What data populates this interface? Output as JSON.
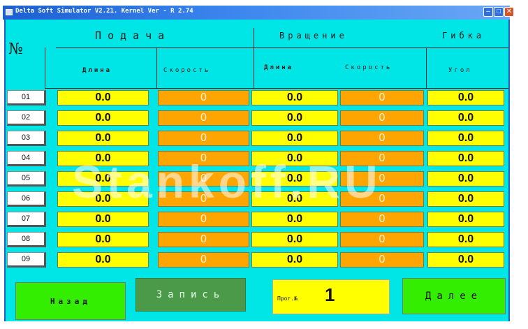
{
  "window": {
    "title": "Delta Soft Simulator V2.21. Kernel Ver - R 2.74",
    "controls": [
      "minimize",
      "maximize",
      "close"
    ]
  },
  "header": {
    "number_label": "№",
    "feed_group": "Подача",
    "rotation_group": "Вращение",
    "bend_group": "Гибка",
    "col_feed_length": "Длина",
    "col_feed_speed": "Скорость",
    "col_rot_length": "Длина",
    "col_rot_speed": "Скорость",
    "col_bend_angle": "Угол"
  },
  "rows": [
    {
      "num": "01",
      "feed_length": "0.0",
      "feed_speed": "0",
      "rot_length": "0.0",
      "rot_speed": "0",
      "angle": "0.0"
    },
    {
      "num": "02",
      "feed_length": "0.0",
      "feed_speed": "0",
      "rot_length": "0.0",
      "rot_speed": "0",
      "angle": "0.0"
    },
    {
      "num": "03",
      "feed_length": "0.0",
      "feed_speed": "0",
      "rot_length": "0.0",
      "rot_speed": "0",
      "angle": "0.0"
    },
    {
      "num": "04",
      "feed_length": "0.0",
      "feed_speed": "0",
      "rot_length": "0.0",
      "rot_speed": "0",
      "angle": "0.0"
    },
    {
      "num": "05",
      "feed_length": "0.0",
      "feed_speed": "0",
      "rot_length": "0.0",
      "rot_speed": "0",
      "angle": "0.0"
    },
    {
      "num": "06",
      "feed_length": "0.0",
      "feed_speed": "0",
      "rot_length": "0.0",
      "rot_speed": "0",
      "angle": "0.0"
    },
    {
      "num": "07",
      "feed_length": "0.0",
      "feed_speed": "0",
      "rot_length": "0.0",
      "rot_speed": "0",
      "angle": "0.0"
    },
    {
      "num": "08",
      "feed_length": "0.0",
      "feed_speed": "0",
      "rot_length": "0.0",
      "rot_speed": "0",
      "angle": "0.0"
    },
    {
      "num": "09",
      "feed_length": "0.0",
      "feed_speed": "0",
      "rot_length": "0.0",
      "rot_speed": "0",
      "angle": "0.0"
    }
  ],
  "footer": {
    "back_label": "Назад",
    "record_label": "Запись",
    "program_label": "Прог.№",
    "program_value": "1",
    "next_label": "Далее"
  },
  "watermark": "Stankoff.RU",
  "colors": {
    "panel": "#00e5e5",
    "yellow_field": "#ffff00",
    "orange_field": "#ffa500",
    "green_button": "#33ee00",
    "record_button": "#4a9a4a"
  }
}
